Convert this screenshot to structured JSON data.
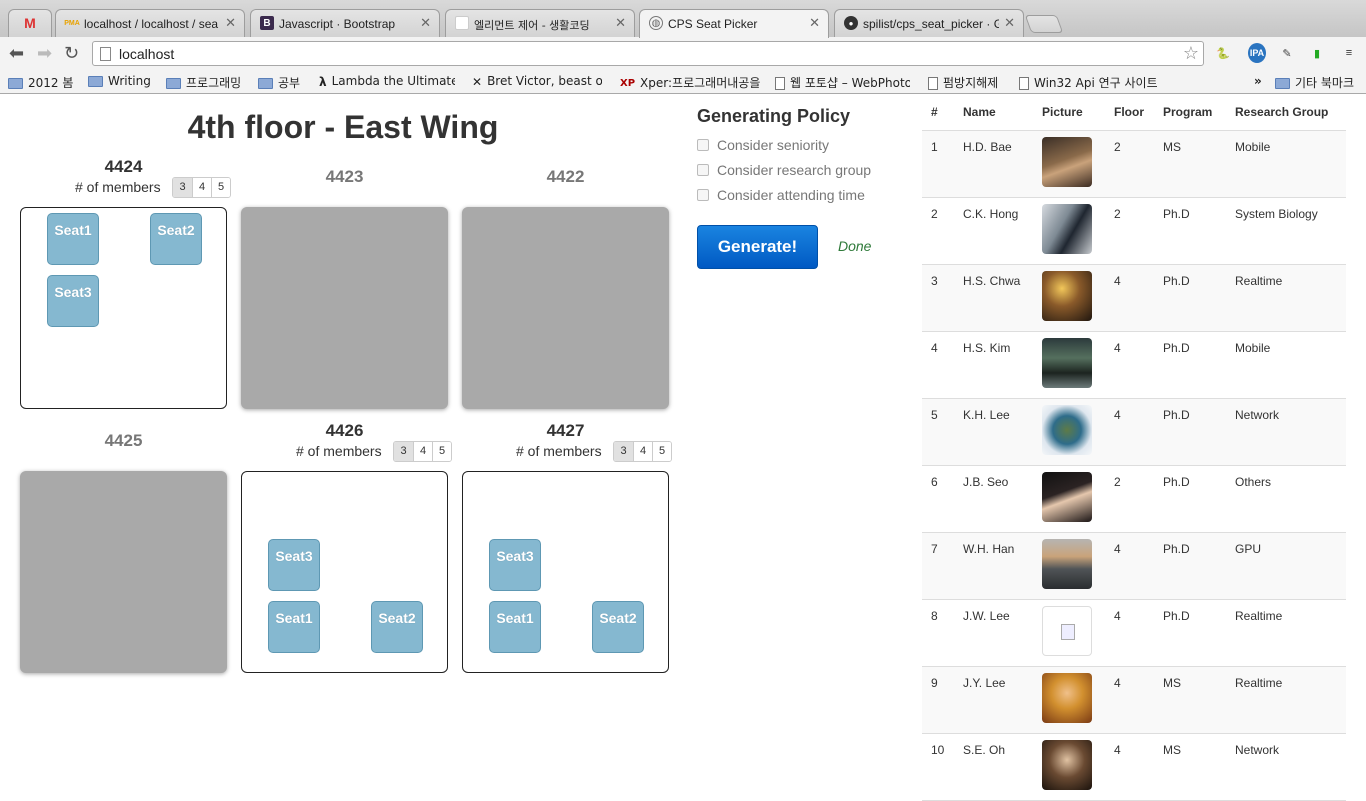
{
  "browser": {
    "tabs": [
      {
        "title": "localhost / localhost / sea",
        "icon": "phpmyadmin-icon",
        "icon_text": "PMA"
      },
      {
        "title": "Javascript · Bootstrap",
        "icon": "bootstrap-icon",
        "icon_text": "B"
      },
      {
        "title": "엘리먼트 제어 - 생활코딩",
        "icon": "blank-page-icon",
        "icon_text": ""
      },
      {
        "title": "CPS Seat Picker",
        "icon": "globe-icon",
        "icon_text": "",
        "active": true
      },
      {
        "title": "spilist/cps_seat_picker · G",
        "icon": "github-icon",
        "icon_text": ""
      }
    ],
    "url": "localhost",
    "bookmarks": [
      {
        "label": "2012 봄",
        "icon": "folder-icon"
      },
      {
        "label": "Writing",
        "icon": "folder-icon"
      },
      {
        "label": "프로그래밍",
        "icon": "folder-icon"
      },
      {
        "label": "공부",
        "icon": "folder-icon"
      },
      {
        "label": "Lambda the Ultimate",
        "icon": "lambda-icon"
      },
      {
        "label": "Bret Victor, beast of",
        "icon": "x-icon"
      },
      {
        "label": "Xper:프로그래머내공을",
        "icon": "xper-icon"
      },
      {
        "label": "웹 포토샵 – WebPhoto",
        "icon": "page-icon"
      },
      {
        "label": "펌방지해제",
        "icon": "page-icon"
      },
      {
        "label": "Win32 Api 연구 사이트",
        "icon": "page-icon"
      }
    ],
    "bookmarks_more": "»",
    "other_bookmarks": "기타 북마크"
  },
  "floor": {
    "title": "4th floor - East Wing",
    "members_label": "# of members",
    "member_options": [
      "3",
      "4",
      "5"
    ],
    "rooms": [
      {
        "number": "4424",
        "active": true,
        "seats": [
          "Seat1",
          "Seat2",
          "Seat3"
        ]
      },
      {
        "number": "4423",
        "active": false,
        "seats": []
      },
      {
        "number": "4422",
        "active": false,
        "seats": []
      },
      {
        "number": "4425",
        "active": false,
        "seats": []
      },
      {
        "number": "4426",
        "active": true,
        "seats": [
          "Seat3",
          "Seat1",
          "Seat2"
        ]
      },
      {
        "number": "4427",
        "active": true,
        "seats": [
          "Seat3",
          "Seat1",
          "Seat2"
        ]
      }
    ]
  },
  "policy": {
    "title": "Generating Policy",
    "options": [
      "Consider seniority",
      "Consider research group",
      "Consider attending time"
    ],
    "generate_label": "Generate!",
    "status": "Done"
  },
  "members_table": {
    "headers": [
      "#",
      "Name",
      "Picture",
      "Floor",
      "Program",
      "Research Group"
    ],
    "rows": [
      {
        "n": "1",
        "name": "H.D. Bae",
        "floor": "2",
        "program": "MS",
        "group": "Mobile",
        "photo": "photo-bae"
      },
      {
        "n": "2",
        "name": "C.K. Hong",
        "floor": "2",
        "program": "Ph.D",
        "group": "System Biology",
        "photo": "photo-hong"
      },
      {
        "n": "3",
        "name": "H.S. Chwa",
        "floor": "4",
        "program": "Ph.D",
        "group": "Realtime",
        "photo": "photo-chwa"
      },
      {
        "n": "4",
        "name": "H.S. Kim",
        "floor": "4",
        "program": "Ph.D",
        "group": "Mobile",
        "photo": "photo-kim"
      },
      {
        "n": "5",
        "name": "K.H. Lee",
        "floor": "4",
        "program": "Ph.D",
        "group": "Network",
        "photo": "photo-khlee"
      },
      {
        "n": "6",
        "name": "J.B. Seo",
        "floor": "2",
        "program": "Ph.D",
        "group": "Others",
        "photo": "photo-seo"
      },
      {
        "n": "7",
        "name": "W.H. Han",
        "floor": "4",
        "program": "Ph.D",
        "group": "GPU",
        "photo": "photo-han"
      },
      {
        "n": "8",
        "name": "J.W. Lee",
        "floor": "4",
        "program": "Ph.D",
        "group": "Realtime",
        "photo": "broken-image-icon"
      },
      {
        "n": "9",
        "name": "J.Y. Lee",
        "floor": "4",
        "program": "MS",
        "group": "Realtime",
        "photo": "photo-jylee"
      },
      {
        "n": "10",
        "name": "S.E. Oh",
        "floor": "4",
        "program": "MS",
        "group": "Network",
        "photo": "photo-oh"
      }
    ]
  }
}
